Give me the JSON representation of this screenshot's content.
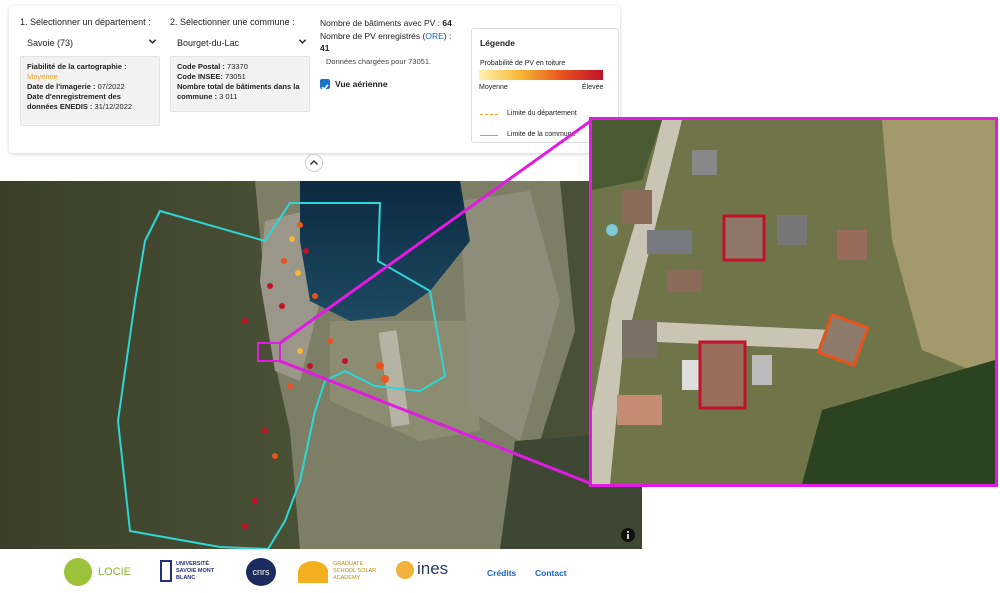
{
  "controls": {
    "department_step_label": "1. Sélectionner un département :",
    "department_value": "Savoie (73)",
    "commune_step_label": "2. Sélectionner une commune :",
    "commune_value": "Bourget-du-Lac"
  },
  "reliability_box": {
    "reliability_label": "Fiabilité de la cartographie :",
    "reliability_value": "Moyenne",
    "imagery_date_label": "Date de l'imagerie :",
    "imagery_date_value": "07/2022",
    "enedis_date_label_1": "Date d'enregistrement des",
    "enedis_date_label_2": "données ENEDIS :",
    "enedis_date_value": "31/12/2022",
    "reliability_color": "#f0a020"
  },
  "commune_box": {
    "postal_code_label": "Code Postal :",
    "postal_code_value": "73370",
    "insee_code_label": "Code INSEE:",
    "insee_code_value": "73051",
    "total_buildings_label_1": "Nombre total de bâtiments dans la",
    "total_buildings_label_2": "commune :",
    "total_buildings_value": "3 011"
  },
  "stats": {
    "pv_buildings_label": "Nombre de bâtiments avec PV :",
    "pv_buildings_value": "64",
    "registered_pv_label": "Nombre de PV enregistrés (",
    "registered_pv_link": "ORE",
    "registered_pv_label_end": ") :",
    "registered_pv_value": "41",
    "loaded_note": "Données chargées pour 73051.",
    "aerial_view_label": "Vue aérienne",
    "aerial_view_checked": true
  },
  "legend": {
    "title": "Légende",
    "probability_label": "Probabilité de PV en toiture",
    "low_label": "Moyenne",
    "high_label": "Élevée",
    "department_limit_label": "Limite du département",
    "commune_limit_label": "Limite de la commune",
    "gradient_colors": [
      "#fff3b0",
      "#f7b733",
      "#e8531d",
      "#c0122a"
    ],
    "department_limit_color": "#f0a020",
    "commune_limit_color": "#2ed6d6",
    "highlight_color": "#e21be2"
  },
  "footer": {
    "logos": [
      {
        "name": "LOCIE"
      },
      {
        "name": "UNIVERSITÉ SAVOIE MONT BLANC"
      },
      {
        "name": "cnrs"
      },
      {
        "name": "GRADUATE SCHOOL SOLAR ACADEMY"
      },
      {
        "name": "ines"
      }
    ],
    "credits_link": "Crédits",
    "contact_link": "Contact"
  }
}
